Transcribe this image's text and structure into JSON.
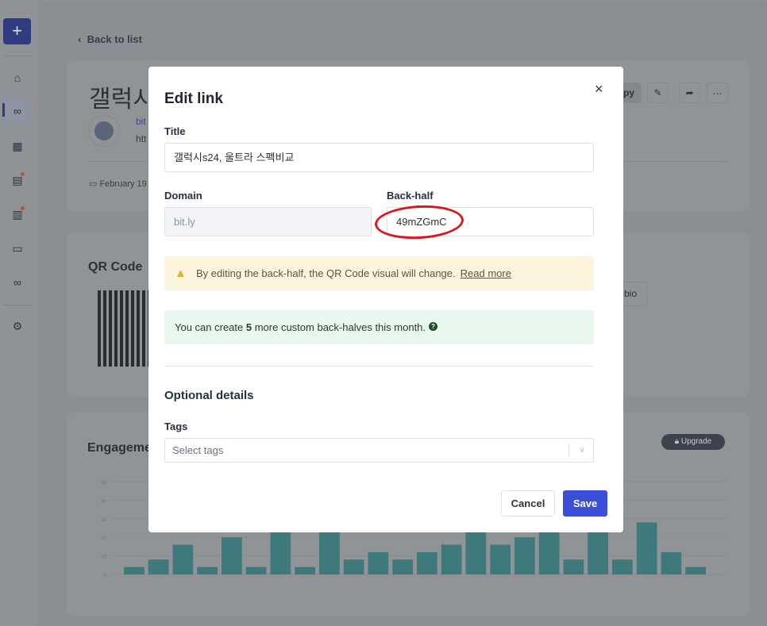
{
  "sidebar": {
    "new_label": "+",
    "items": [
      {
        "icon": "home-icon"
      },
      {
        "icon": "link-icon",
        "active": true
      },
      {
        "icon": "qr-code-icon"
      },
      {
        "icon": "page-icon",
        "badge": true
      },
      {
        "icon": "analytics-icon",
        "badge": true
      },
      {
        "icon": "folder-star-icon"
      },
      {
        "icon": "link-add-icon"
      },
      {
        "icon": "gear-icon"
      }
    ]
  },
  "page": {
    "back_label": "Back to list",
    "link_title": "갤럭시",
    "short_link": "bit",
    "long_link": "htt",
    "date": "February 19",
    "copy_label": "Copy",
    "qr_title": "QR Code",
    "bio_label": "bio",
    "engagement_title": "Engagements",
    "upgrade_label": "Upgrade"
  },
  "modal": {
    "title": "Edit link",
    "close": "×",
    "title_label": "Title",
    "title_value": "갤럭시s24, 울트라 스펙비교",
    "domain_label": "Domain",
    "domain_value": "bit.ly",
    "backhalf_label": "Back-half",
    "backhalf_value": "49mZGmC",
    "warning_text": "By editing the back-half, the QR Code visual will change.",
    "warning_link": "Read more",
    "info_prefix": "You can create ",
    "info_count": "5",
    "info_suffix": " more custom back-halves this month.",
    "optional_title": "Optional details",
    "tags_label": "Tags",
    "tags_placeholder": "Select tags",
    "cancel_label": "Cancel",
    "save_label": "Save"
  },
  "colors": {
    "primary": "#3b4fd8",
    "bar": "#3e7a7c",
    "warning_bg": "#fcf4dc",
    "info_bg": "#e8f8ee",
    "annotation": "#d9191f"
  },
  "chart_data": {
    "type": "bar",
    "values": [
      4,
      8,
      16,
      4,
      20,
      4,
      24,
      4,
      24,
      8,
      12,
      8,
      12,
      16,
      24,
      16,
      20,
      24,
      8,
      24,
      8,
      28,
      12,
      4
    ],
    "yticks": [
      "0",
      "10",
      "20",
      "30",
      "40",
      "50"
    ],
    "ylim": [
      0,
      50
    ],
    "grid": true
  }
}
